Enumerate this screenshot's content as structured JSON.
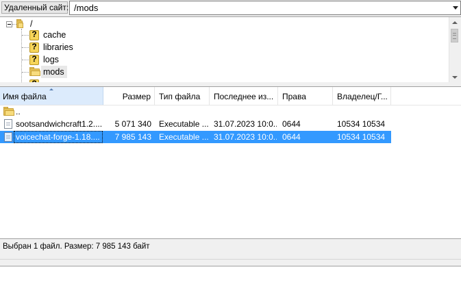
{
  "path_bar": {
    "label": "Удаленный сайт:",
    "value": "/mods"
  },
  "tree": {
    "root": "/",
    "items": [
      {
        "name": "cache",
        "icon": "question-folder-icon"
      },
      {
        "name": "libraries",
        "icon": "question-folder-icon"
      },
      {
        "name": "logs",
        "icon": "question-folder-icon"
      },
      {
        "name": "mods",
        "icon": "folder-icon",
        "selected": true
      }
    ]
  },
  "file_list": {
    "columns": [
      "Имя файла",
      "Размер",
      "Тип файла",
      "Последнее из...",
      "Права",
      "Владелец/Г..."
    ],
    "sorted_column": "Имя файла",
    "parent_dir": "..",
    "rows": [
      {
        "name": "sootsandwichcraft1.2....",
        "size": "5 071 340",
        "type": "Executable ...",
        "modified": "31.07.2023 10:0...",
        "perms": "0644",
        "owner": "10534 10534",
        "selected": false
      },
      {
        "name": "voicechat-forge-1.18....",
        "size": "7 985 143",
        "type": "Executable ...",
        "modified": "31.07.2023 10:0...",
        "perms": "0644",
        "owner": "10534 10534",
        "selected": true
      }
    ]
  },
  "status": {
    "text": "Выбран 1 файл. Размер: 7 985 143 байт"
  },
  "colors": {
    "selection": "#3399ff",
    "sorted_header": "#dcebfc",
    "folder": "#e7c45a"
  }
}
